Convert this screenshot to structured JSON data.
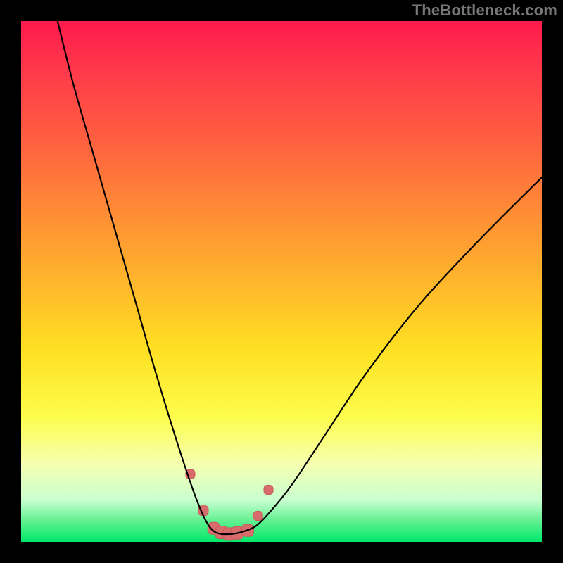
{
  "watermark": {
    "text": "TheBottleneck.com"
  },
  "colors": {
    "curve": "#000000",
    "markers_fill": "#d86b6b",
    "markers_stroke": "#c95a5a",
    "frame_bg": "#000000"
  },
  "gradient_stops": [
    {
      "pct": 0,
      "hex": "#ff1a4d"
    },
    {
      "pct": 10,
      "hex": "#ff3b4a"
    },
    {
      "pct": 23,
      "hex": "#ff6040"
    },
    {
      "pct": 36,
      "hex": "#ff8a36"
    },
    {
      "pct": 50,
      "hex": "#ffb62c"
    },
    {
      "pct": 63,
      "hex": "#ffe022"
    },
    {
      "pct": 76,
      "hex": "#fdfd4c"
    },
    {
      "pct": 85,
      "hex": "#f6ffb0"
    },
    {
      "pct": 92,
      "hex": "#c8ffd0"
    },
    {
      "pct": 96,
      "hex": "#60f090"
    },
    {
      "pct": 100,
      "hex": "#00e86a"
    }
  ],
  "chart_data": {
    "type": "line",
    "title": "",
    "xlabel": "",
    "ylabel": "",
    "grid": false,
    "legend": false,
    "xlim": [
      0,
      100
    ],
    "ylim": [
      0,
      100
    ],
    "series": [
      {
        "name": "bottleneck-curve",
        "x": [
          7,
          10,
          14,
          18,
          22,
          26,
          30,
          33,
          35,
          36.5,
          38,
          40,
          42,
          45,
          48,
          52,
          58,
          66,
          76,
          88,
          100
        ],
        "y": [
          100,
          88,
          74,
          60,
          46,
          32,
          19,
          10,
          5,
          2.5,
          1.6,
          1.5,
          1.8,
          3,
          6,
          11,
          20,
          32,
          45,
          58,
          70
        ]
      }
    ],
    "markers": {
      "name": "highlight-points",
      "shape": "rounded-square",
      "x": [
        32.5,
        35,
        37,
        38.5,
        40,
        41.5,
        43.5,
        45.5,
        47.5
      ],
      "y": [
        13,
        6,
        2.6,
        1.8,
        1.5,
        1.7,
        2.2,
        5,
        10
      ],
      "size": [
        13,
        14,
        17,
        18,
        18,
        18,
        17,
        13,
        13
      ]
    }
  }
}
